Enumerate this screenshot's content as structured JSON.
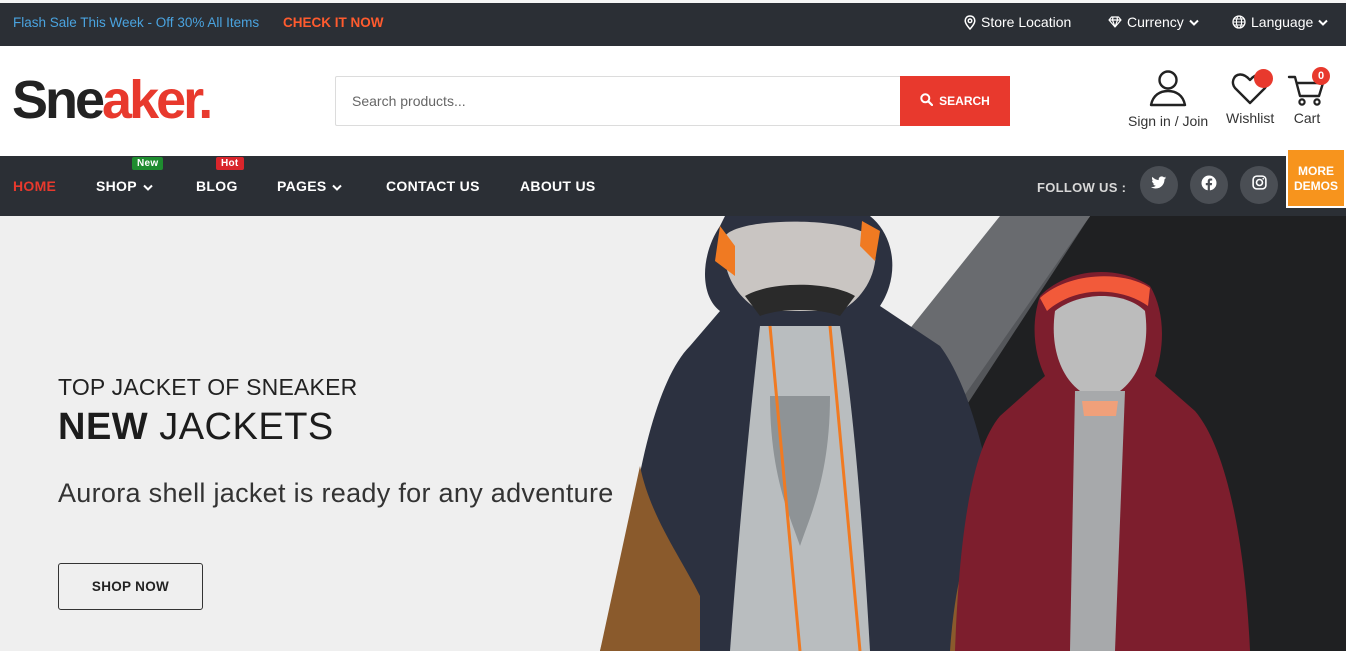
{
  "topbar": {
    "promo_text": "Flash Sale This Week - Off 30% All Items",
    "promo_link": "CHECK IT NOW",
    "store_location": "Store Location",
    "currency": "Currency",
    "language": "Language"
  },
  "header": {
    "logo_main": "Sne",
    "logo_middle": "ak",
    "logo_accent": "er.",
    "search_placeholder": "Search products...",
    "search_button": "SEARCH",
    "signin_label": "Sign in / Join",
    "wishlist_label": "Wishlist",
    "cart_label": "Cart",
    "cart_count": "0"
  },
  "nav": {
    "items": [
      {
        "label": "HOME"
      },
      {
        "label": "SHOP",
        "tag": "New"
      },
      {
        "label": "BLOG",
        "tag": "Hot"
      },
      {
        "label": "PAGES"
      },
      {
        "label": "CONTACT US"
      },
      {
        "label": "ABOUT US"
      }
    ],
    "follow_label": "FOLLOW US :",
    "more_demos_line1": "MORE",
    "more_demos_line2": "DEMOS"
  },
  "hero": {
    "subtitle": "TOP JACKET OF SNEAKER",
    "title_bold": "NEW",
    "title_rest": " JACKETS",
    "description": "Aurora shell jacket is ready for any adventure",
    "button": "SHOP NOW"
  },
  "colors": {
    "accent_red": "#e8392d",
    "dark_bar": "#2b2f35",
    "promo_blue": "#4aa3df",
    "promo_link_orange": "#ff5b2e",
    "orange_tab": "#f7941d"
  },
  "icons": [
    "map-pin-icon",
    "diamond-icon",
    "globe-icon",
    "chevron-down-icon",
    "search-icon",
    "user-icon",
    "heart-icon",
    "cart-icon",
    "twitter-icon",
    "facebook-icon",
    "instagram-icon"
  ]
}
